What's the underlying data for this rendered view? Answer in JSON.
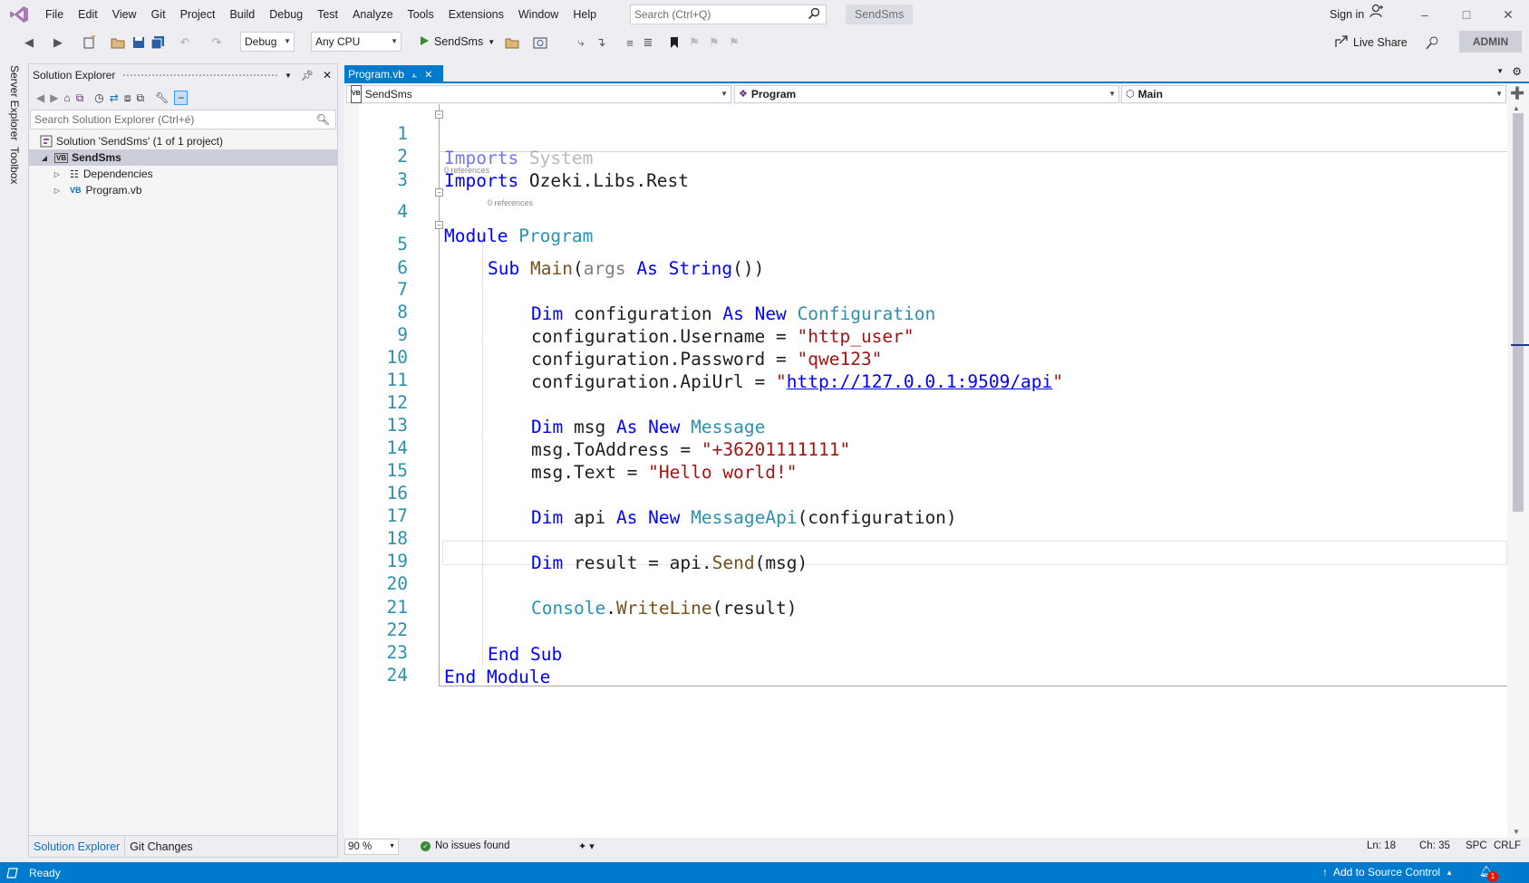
{
  "menu": {
    "items": [
      "File",
      "Edit",
      "View",
      "Git",
      "Project",
      "Build",
      "Debug",
      "Test",
      "Analyze",
      "Tools",
      "Extensions",
      "Window",
      "Help"
    ],
    "search_placeholder": "Search (Ctrl+Q)",
    "solution_badge": "SendSms",
    "sign_in": "Sign in"
  },
  "toolbar": {
    "config": "Debug",
    "platform": "Any CPU",
    "run_target": "SendSms",
    "live_share": "Live Share",
    "admin": "ADMIN"
  },
  "side_tabs": [
    "Server Explorer",
    "Toolbox"
  ],
  "solution_explorer": {
    "title": "Solution Explorer",
    "search_placeholder": "Search Solution Explorer (Ctrl+é)",
    "solution": "Solution 'SendSms' (1 of 1 project)",
    "project": "SendSms",
    "dependencies": "Dependencies",
    "file": "Program.vb",
    "bottom_tabs": [
      "Solution Explorer",
      "Git Changes"
    ]
  },
  "editor": {
    "tab": "Program.vb",
    "nav": {
      "project": "SendSms",
      "type": "Program",
      "member": "Main"
    },
    "references_label": "0 references",
    "line_numbers": [
      "1",
      "2",
      "3",
      "4",
      "5",
      "6",
      "7",
      "8",
      "9",
      "10",
      "11",
      "12",
      "13",
      "14",
      "15",
      "16",
      "17",
      "18",
      "19",
      "20",
      "21",
      "22",
      "23",
      "24"
    ],
    "code": {
      "l1": [
        "Imports",
        " System"
      ],
      "l2": [
        "Imports",
        " Ozeki.Libs.Rest"
      ],
      "l4": [
        "Module",
        " ",
        "Program"
      ],
      "l5": [
        "Sub",
        " ",
        "Main",
        "(",
        "args",
        " ",
        "As",
        " ",
        "String",
        "())"
      ],
      "l7": [
        "Dim",
        " configuration ",
        "As",
        " ",
        "New",
        " ",
        "Configuration"
      ],
      "l8": [
        "configuration.Username = ",
        "\"http_user\""
      ],
      "l9": [
        "configuration.Password = ",
        "\"qwe123\""
      ],
      "l10": [
        "configuration.ApiUrl = ",
        "\"",
        "http://127.0.0.1:9509/api",
        "\""
      ],
      "l12": [
        "Dim",
        " msg ",
        "As",
        " ",
        "New",
        " ",
        "Message"
      ],
      "l13": [
        "msg.ToAddress = ",
        "\"+36201111111\""
      ],
      "l14": [
        "msg.Text = ",
        "\"Hello world!\""
      ],
      "l16": [
        "Dim",
        " api ",
        "As",
        " ",
        "New",
        " ",
        "MessageApi",
        "(configuration)"
      ],
      "l18": [
        "Dim",
        " result = api.",
        "Send",
        "(msg)"
      ],
      "l20": [
        "Console",
        ".",
        "WriteLine",
        "(result)"
      ],
      "l22": [
        "End Sub"
      ],
      "l23": [
        "End Module"
      ]
    },
    "zoom": "90 %",
    "issues": "No issues found",
    "ln": "Ln: 18",
    "ch": "Ch: 35",
    "spc": "SPC",
    "crlf": "CRLF"
  },
  "status": {
    "ready": "Ready",
    "source_control": "Add to Source Control",
    "notifications": "1"
  },
  "colors": {
    "accent": "#007acc",
    "keyword": "#0000ff",
    "type": "#2b91af",
    "string": "#a31515",
    "method": "#74531f"
  }
}
